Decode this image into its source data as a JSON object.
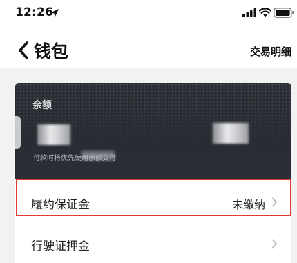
{
  "status_bar": {
    "time": "12:26",
    "icons": [
      "location-arrow-icon",
      "signal-icon",
      "wifi-icon",
      "battery-icon"
    ]
  },
  "nav": {
    "back_icon": "chevron-left-icon",
    "title": "钱包",
    "action_label": "交易明细"
  },
  "balance_card": {
    "label": "余额",
    "hint": "付款时将优先使用余额支付"
  },
  "list": {
    "items": [
      {
        "label": "履约保证金",
        "value": "未缴纳",
        "highlighted": true
      },
      {
        "label": "行驶证押金",
        "value": ""
      }
    ]
  },
  "colors": {
    "card_background": "#2a2d33",
    "highlight_border": "#e23a31",
    "page_background": "#f2f2f2"
  }
}
